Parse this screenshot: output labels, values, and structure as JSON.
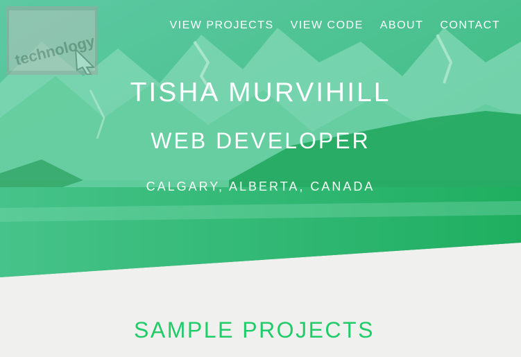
{
  "header": {
    "logo_text": "technology",
    "nav": [
      {
        "label": "VIEW  PROJECTS"
      },
      {
        "label": "VIEW  CODE"
      },
      {
        "label": "ABOUT"
      },
      {
        "label": "CONTACT"
      }
    ]
  },
  "hero": {
    "name": "TISHA MURVIHILL",
    "role": "WEB DEVELOPER",
    "location": "CALGARY,  ALBERTA,  CANADA"
  },
  "projects": {
    "title": "SAMPLE  PROJECTS"
  },
  "colors": {
    "accent": "#1fcc68",
    "hero_overlay": "#2fbf7a",
    "background": "#f0f0ee"
  }
}
